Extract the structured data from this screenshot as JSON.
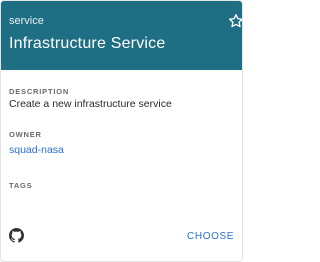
{
  "card": {
    "subtitle": "service",
    "title": "Infrastructure Service",
    "description_label": "DESCRIPTION",
    "description": "Create a new infrastructure service",
    "owner_label": "OWNER",
    "owner": "squad-nasa",
    "tags_label": "TAGS",
    "choose_label": "CHOOSE",
    "header_color": "#1f6f84",
    "accent_color": "#2b6fd6",
    "icons": {
      "favorite": "star-outline-icon",
      "source": "github-icon"
    }
  }
}
